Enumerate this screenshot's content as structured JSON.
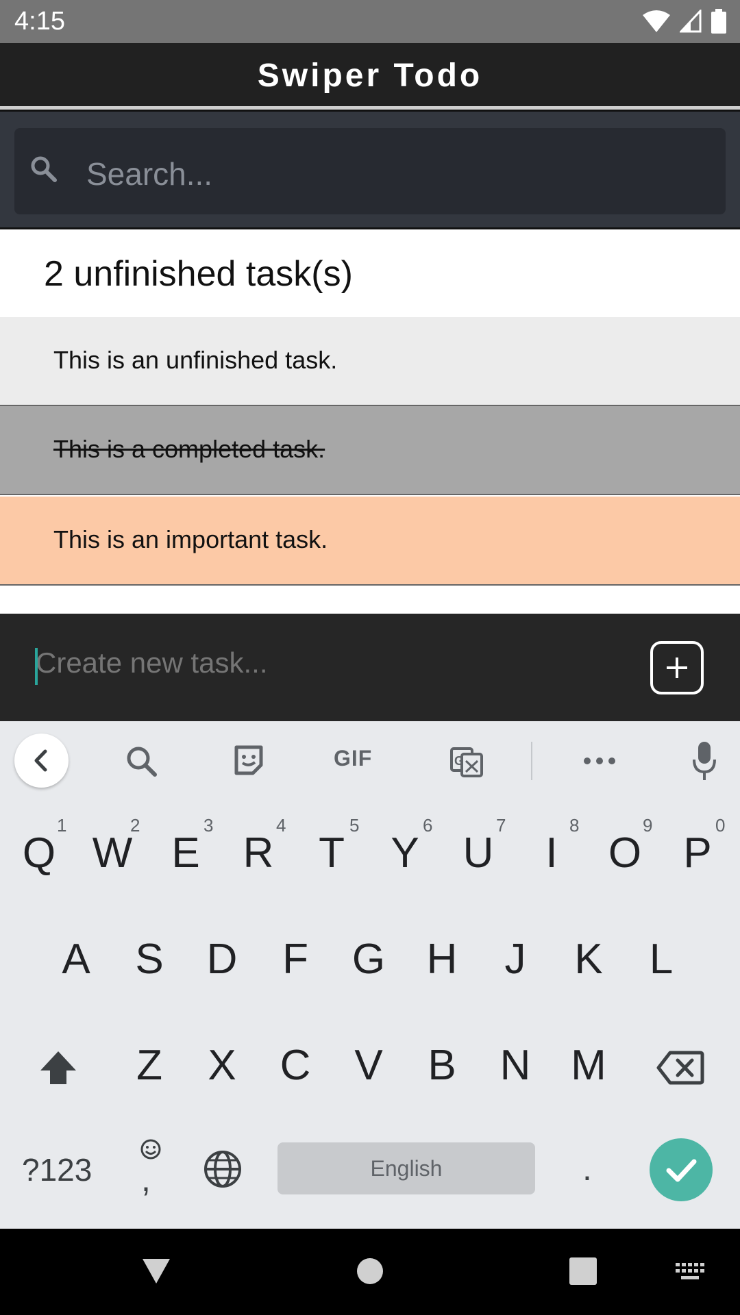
{
  "status_bar": {
    "time": "4:15"
  },
  "app_bar": {
    "title": "Swiper Todo"
  },
  "search": {
    "placeholder": "Search..."
  },
  "summary": {
    "unfinished_count_text": "2 unfinished task(s)"
  },
  "tasks": [
    {
      "text": "This is an unfinished task.",
      "state": "unfinished",
      "color": "#ececec"
    },
    {
      "text": "This is a completed task.",
      "state": "completed",
      "color": "#a7a7a7"
    },
    {
      "text": "This is an important task.",
      "state": "important",
      "color": "#fcc9a6"
    }
  ],
  "new_task": {
    "placeholder": "Create new task..."
  },
  "keyboard": {
    "toolbar": {
      "gif_label": "GIF"
    },
    "row1": [
      "Q",
      "W",
      "E",
      "R",
      "T",
      "Y",
      "U",
      "I",
      "O",
      "P"
    ],
    "row1_hints": [
      "1",
      "2",
      "3",
      "4",
      "5",
      "6",
      "7",
      "8",
      "9",
      "0"
    ],
    "row2": [
      "A",
      "S",
      "D",
      "F",
      "G",
      "H",
      "J",
      "K",
      "L"
    ],
    "row3": [
      "Z",
      "X",
      "C",
      "V",
      "B",
      "N",
      "M"
    ],
    "symbols_label": "?123",
    "comma": ",",
    "space_label": "English",
    "period": "."
  },
  "colors": {
    "app_bar": "#212121",
    "search_panel": "#33373f",
    "accent": "#4db6a5",
    "important": "#fcc9a6"
  }
}
